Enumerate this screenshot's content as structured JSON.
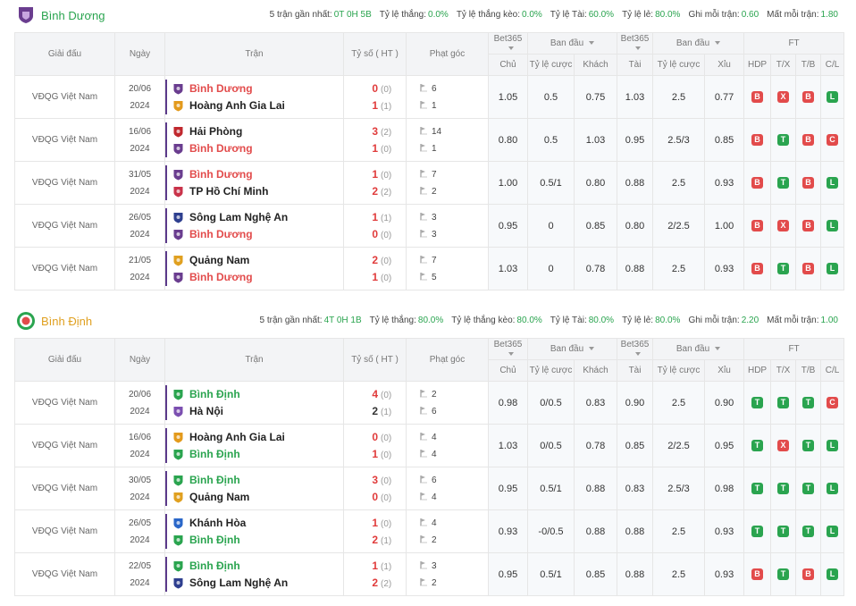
{
  "sections": [
    {
      "team": "Bình Dương",
      "team_color": "#2aa44f",
      "stats": [
        {
          "label": "5 trận gần nhất:",
          "value": "0T 0H 5B"
        },
        {
          "label": "Tỷ lệ thắng:",
          "value": "0.0%"
        },
        {
          "label": "Tỷ lệ thắng kèo:",
          "value": "0.0%"
        },
        {
          "label": "Tỷ lệ Tài:",
          "value": "60.0%"
        },
        {
          "label": "Tỷ lệ lẻ:",
          "value": "80.0%"
        },
        {
          "label": "Ghi mỗi trận:",
          "value": "0.60"
        },
        {
          "label": "Mất mỗi trận:",
          "value": "1.80"
        }
      ],
      "headers": {
        "league": "Giải đấu",
        "date": "Ngày",
        "match": "Trận",
        "score": "Tỷ số ( HT )",
        "corner": "Phạt góc",
        "bet1": "Bet365",
        "open1": "Ban đầu",
        "bet2": "Bet365",
        "open2": "Ban đầu",
        "ft": "FT",
        "home": "Chủ",
        "rate": "Tỷ lệ cược",
        "away": "Khách",
        "over": "Tài",
        "rate2": "Tỷ lệ cược",
        "under": "Xỉu",
        "hdp": "HDP",
        "tx": "T/X",
        "tb": "T/B",
        "cl": "C/L"
      },
      "rows": [
        {
          "league": "VĐQG Việt Nam",
          "date1": "20/06",
          "date2": "2024",
          "home": "Bình Dương",
          "home_hl": "red",
          "home_logo": "bd",
          "away": "Hoàng Anh Gia Lai",
          "away_hl": "",
          "away_logo": "hagl",
          "hs": "0",
          "hht": "(0)",
          "as": "1",
          "aht": "(1)",
          "hs_red": true,
          "as_red": true,
          "hc": "6",
          "ac": "1",
          "o1": "1.05",
          "o2": "0.5",
          "o3": "0.75",
          "o4": "1.03",
          "o5": "2.5",
          "o6": "0.77",
          "ft": [
            "B",
            "X",
            "B",
            "L"
          ]
        },
        {
          "league": "VĐQG Việt Nam",
          "date1": "16/06",
          "date2": "2024",
          "home": "Hải Phòng",
          "home_hl": "",
          "home_logo": "hp",
          "away": "Bình Dương",
          "away_hl": "red",
          "away_logo": "bd",
          "hs": "3",
          "hht": "(2)",
          "as": "1",
          "aht": "(0)",
          "hs_red": true,
          "as_red": true,
          "hc": "14",
          "ac": "1",
          "o1": "0.80",
          "o2": "0.5",
          "o3": "1.03",
          "o4": "0.95",
          "o5": "2.5/3",
          "o6": "0.85",
          "ft": [
            "B",
            "T",
            "B",
            "C"
          ]
        },
        {
          "league": "VĐQG Việt Nam",
          "date1": "31/05",
          "date2": "2024",
          "home": "Bình Dương",
          "home_hl": "red",
          "home_logo": "bd",
          "away": "TP Hồ Chí Minh",
          "away_hl": "",
          "away_logo": "hcm",
          "hs": "1",
          "hht": "(0)",
          "as": "2",
          "aht": "(2)",
          "hs_red": true,
          "as_red": true,
          "hc": "7",
          "ac": "2",
          "o1": "1.00",
          "o2": "0.5/1",
          "o3": "0.80",
          "o4": "0.88",
          "o5": "2.5",
          "o6": "0.93",
          "ft": [
            "B",
            "T",
            "B",
            "L"
          ]
        },
        {
          "league": "VĐQG Việt Nam",
          "date1": "26/05",
          "date2": "2024",
          "home": "Sông Lam Nghệ An",
          "home_hl": "",
          "home_logo": "slna",
          "away": "Bình Dương",
          "away_hl": "red",
          "away_logo": "bd",
          "hs": "1",
          "hht": "(1)",
          "as": "0",
          "aht": "(0)",
          "hs_red": true,
          "as_red": true,
          "hc": "3",
          "ac": "3",
          "o1": "0.95",
          "o2": "0",
          "o3": "0.85",
          "o4": "0.80",
          "o5": "2/2.5",
          "o6": "1.00",
          "ft": [
            "B",
            "X",
            "B",
            "L"
          ]
        },
        {
          "league": "VĐQG Việt Nam",
          "date1": "21/05",
          "date2": "2024",
          "home": "Quảng Nam",
          "home_hl": "",
          "home_logo": "qn",
          "away": "Bình Dương",
          "away_hl": "red",
          "away_logo": "bd",
          "hs": "2",
          "hht": "(0)",
          "as": "1",
          "aht": "(0)",
          "hs_red": true,
          "as_red": true,
          "hc": "7",
          "ac": "5",
          "o1": "1.03",
          "o2": "0",
          "o3": "0.78",
          "o4": "0.88",
          "o5": "2.5",
          "o6": "0.93",
          "ft": [
            "B",
            "T",
            "B",
            "L"
          ]
        }
      ]
    },
    {
      "team": "Bình Định",
      "team_color": "#e0a020",
      "stats": [
        {
          "label": "5 trận gần nhất:",
          "value": "4T 0H 1B"
        },
        {
          "label": "Tỷ lệ thắng:",
          "value": "80.0%"
        },
        {
          "label": "Tỷ lệ thắng kèo:",
          "value": "80.0%"
        },
        {
          "label": "Tỷ lệ Tài:",
          "value": "80.0%"
        },
        {
          "label": "Tỷ lệ lẻ:",
          "value": "80.0%"
        },
        {
          "label": "Ghi mỗi trận:",
          "value": "2.20"
        },
        {
          "label": "Mất mỗi trận:",
          "value": "1.00"
        }
      ],
      "headers": {
        "league": "Giải đấu",
        "date": "Ngày",
        "match": "Trận",
        "score": "Tỷ số ( HT )",
        "corner": "Phạt góc",
        "bet1": "Bet365",
        "open1": "Ban đầu",
        "bet2": "Bet365",
        "open2": "Ban đầu",
        "ft": "FT",
        "home": "Chủ",
        "rate": "Tỷ lệ cược",
        "away": "Khách",
        "over": "Tài",
        "rate2": "Tỷ lệ cược",
        "under": "Xỉu",
        "hdp": "HDP",
        "tx": "T/X",
        "tb": "T/B",
        "cl": "C/L"
      },
      "rows": [
        {
          "league": "VĐQG Việt Nam",
          "date1": "20/06",
          "date2": "2024",
          "home": "Bình Định",
          "home_hl": "green",
          "home_logo": "bdh",
          "away": "Hà Nội",
          "away_hl": "",
          "away_logo": "hn",
          "hs": "4",
          "hht": "(0)",
          "as": "2",
          "aht": "(1)",
          "hs_red": true,
          "as_red": false,
          "hc": "2",
          "ac": "6",
          "o1": "0.98",
          "o2": "0/0.5",
          "o3": "0.83",
          "o4": "0.90",
          "o5": "2.5",
          "o6": "0.90",
          "ft": [
            "T",
            "T",
            "T",
            "C"
          ]
        },
        {
          "league": "VĐQG Việt Nam",
          "date1": "16/06",
          "date2": "2024",
          "home": "Hoàng Anh Gia Lai",
          "home_hl": "",
          "home_logo": "hagl",
          "away": "Bình Định",
          "away_hl": "green",
          "away_logo": "bdh",
          "hs": "0",
          "hht": "(0)",
          "as": "1",
          "aht": "(0)",
          "hs_red": true,
          "as_red": true,
          "hc": "4",
          "ac": "4",
          "o1": "1.03",
          "o2": "0/0.5",
          "o3": "0.78",
          "o4": "0.85",
          "o5": "2/2.5",
          "o6": "0.95",
          "ft": [
            "T",
            "X",
            "T",
            "L"
          ]
        },
        {
          "league": "VĐQG Việt Nam",
          "date1": "30/05",
          "date2": "2024",
          "home": "Bình Định",
          "home_hl": "green",
          "home_logo": "bdh",
          "away": "Quảng Nam",
          "away_hl": "",
          "away_logo": "qn",
          "hs": "3",
          "hht": "(0)",
          "as": "0",
          "aht": "(0)",
          "hs_red": true,
          "as_red": true,
          "hc": "6",
          "ac": "4",
          "o1": "0.95",
          "o2": "0.5/1",
          "o3": "0.88",
          "o4": "0.83",
          "o5": "2.5/3",
          "o6": "0.98",
          "ft": [
            "T",
            "T",
            "T",
            "L"
          ]
        },
        {
          "league": "VĐQG Việt Nam",
          "date1": "26/05",
          "date2": "2024",
          "home": "Khánh Hòa",
          "home_hl": "",
          "home_logo": "kh",
          "away": "Bình Định",
          "away_hl": "green",
          "away_logo": "bdh",
          "hs": "1",
          "hht": "(0)",
          "as": "2",
          "aht": "(1)",
          "hs_red": true,
          "as_red": true,
          "hc": "4",
          "ac": "2",
          "o1": "0.93",
          "o2": "-0/0.5",
          "o3": "0.88",
          "o4": "0.88",
          "o5": "2.5",
          "o6": "0.93",
          "ft": [
            "T",
            "T",
            "T",
            "L"
          ]
        },
        {
          "league": "VĐQG Việt Nam",
          "date1": "22/05",
          "date2": "2024",
          "home": "Bình Định",
          "home_hl": "green",
          "home_logo": "bdh",
          "away": "Sông Lam Nghệ An",
          "away_hl": "",
          "away_logo": "slna",
          "hs": "1",
          "hht": "(1)",
          "as": "2",
          "aht": "(2)",
          "hs_red": true,
          "as_red": true,
          "hc": "3",
          "ac": "2",
          "o1": "0.95",
          "o2": "0.5/1",
          "o3": "0.85",
          "o4": "0.88",
          "o5": "2.5",
          "o6": "0.93",
          "ft": [
            "B",
            "T",
            "B",
            "L"
          ]
        }
      ]
    }
  ],
  "logo_colors": {
    "bd": "#6a3d8f",
    "hagl": "#e39a1c",
    "hp": "#c0282e",
    "hcm": "#c9334a",
    "slna": "#2e3f8f",
    "qn": "#e0a020",
    "bdh": "#2aa44f",
    "hn": "#7b4fb0",
    "kh": "#2a67c9"
  }
}
